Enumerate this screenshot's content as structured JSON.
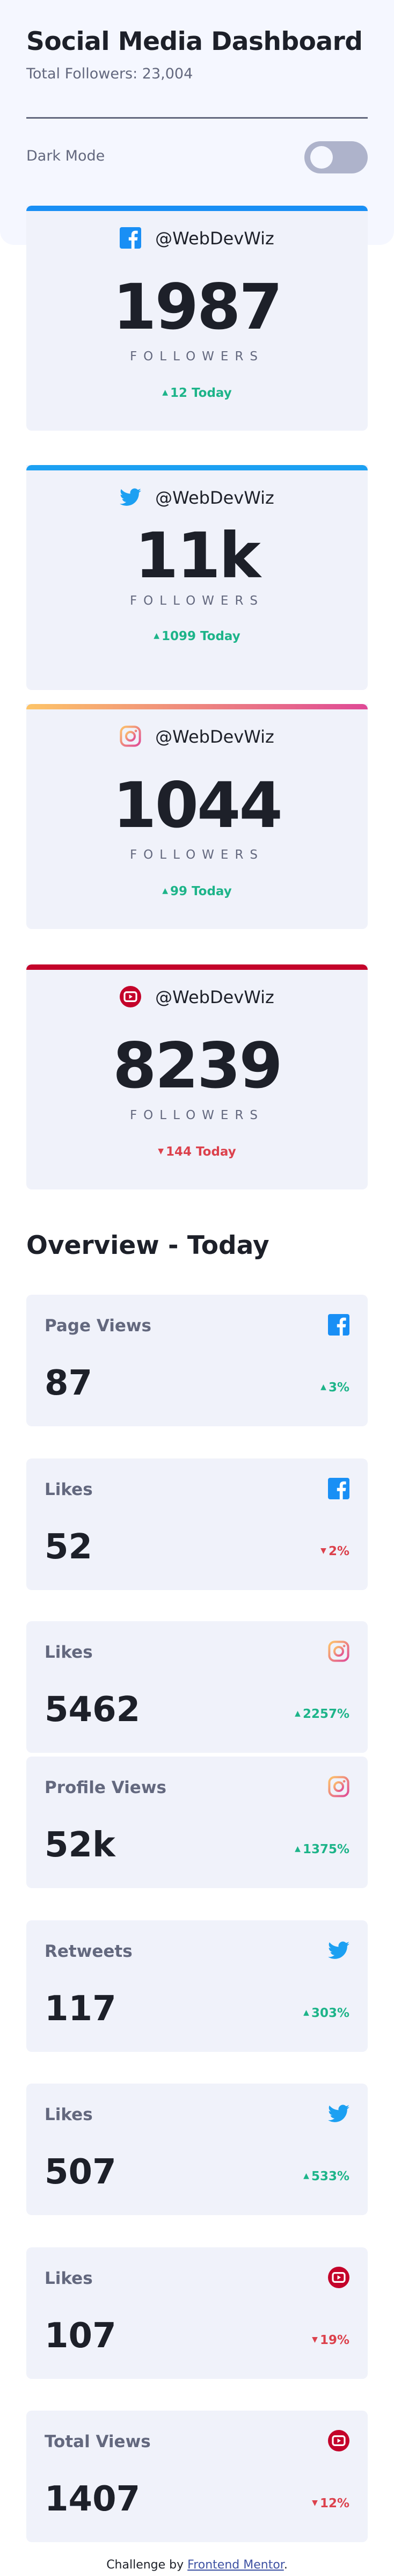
{
  "header": {
    "title": "Social Media Dashboard",
    "total_followers": "Total Followers: 23,004",
    "dark_mode_label": "Dark Mode",
    "dark_mode_on": false
  },
  "follower_cards": [
    {
      "network": "facebook",
      "icon": "facebook-icon",
      "accent": "#198ff5",
      "handle": "@WebDevWiz",
      "count": "1987",
      "label": "FOLLOWERS",
      "today": "12 Today",
      "trend": "up"
    },
    {
      "network": "twitter",
      "icon": "twitter-icon",
      "accent": "#1ca0f2",
      "handle": "@WebDevWiz",
      "count": "11k",
      "label": "FOLLOWERS",
      "today": "1099 Today",
      "trend": "up"
    },
    {
      "network": "instagram",
      "icon": "instagram-icon",
      "accent": "#e8847a",
      "handle": "@WebDevWiz",
      "count": "1044",
      "label": "FOLLOWERS",
      "today": "99 Today",
      "trend": "up"
    },
    {
      "network": "youtube",
      "icon": "youtube-icon",
      "accent": "#c4032a",
      "handle": "@WebDevWiz",
      "count": "8239",
      "label": "FOLLOWERS",
      "today": "144 Today",
      "trend": "down"
    }
  ],
  "overview": {
    "title": "Overview - Today",
    "cards": [
      {
        "label": "Page Views",
        "network": "facebook",
        "icon": "facebook-icon",
        "value": "87",
        "change": "3%",
        "trend": "up"
      },
      {
        "label": "Likes",
        "network": "facebook",
        "icon": "facebook-icon",
        "value": "52",
        "change": "2%",
        "trend": "down"
      },
      {
        "label": "Likes",
        "network": "instagram",
        "icon": "instagram-icon",
        "value": "5462",
        "change": "2257%",
        "trend": "up"
      },
      {
        "label": "Profile Views",
        "network": "instagram",
        "icon": "instagram-icon",
        "value": "52k",
        "change": "1375%",
        "trend": "up"
      },
      {
        "label": "Retweets",
        "network": "twitter",
        "icon": "twitter-icon",
        "value": "117",
        "change": "303%",
        "trend": "up"
      },
      {
        "label": "Likes",
        "network": "twitter",
        "icon": "twitter-icon",
        "value": "507",
        "change": "533%",
        "trend": "up"
      },
      {
        "label": "Likes",
        "network": "youtube",
        "icon": "youtube-icon",
        "value": "107",
        "change": "19%",
        "trend": "down"
      },
      {
        "label": "Total Views",
        "network": "youtube",
        "icon": "youtube-icon",
        "value": "1407",
        "change": "12%",
        "trend": "down"
      }
    ]
  },
  "footer": {
    "prefix": "Challenge by",
    "link": "Frontend Mentor",
    "suffix": "."
  },
  "colors": {
    "up": "#1db489",
    "down": "#dc414c",
    "facebook": "#198ff5",
    "twitter": "#1ca0f2",
    "instagram_start": "#fdc468",
    "instagram_end": "#df4996",
    "youtube": "#c4032a"
  }
}
